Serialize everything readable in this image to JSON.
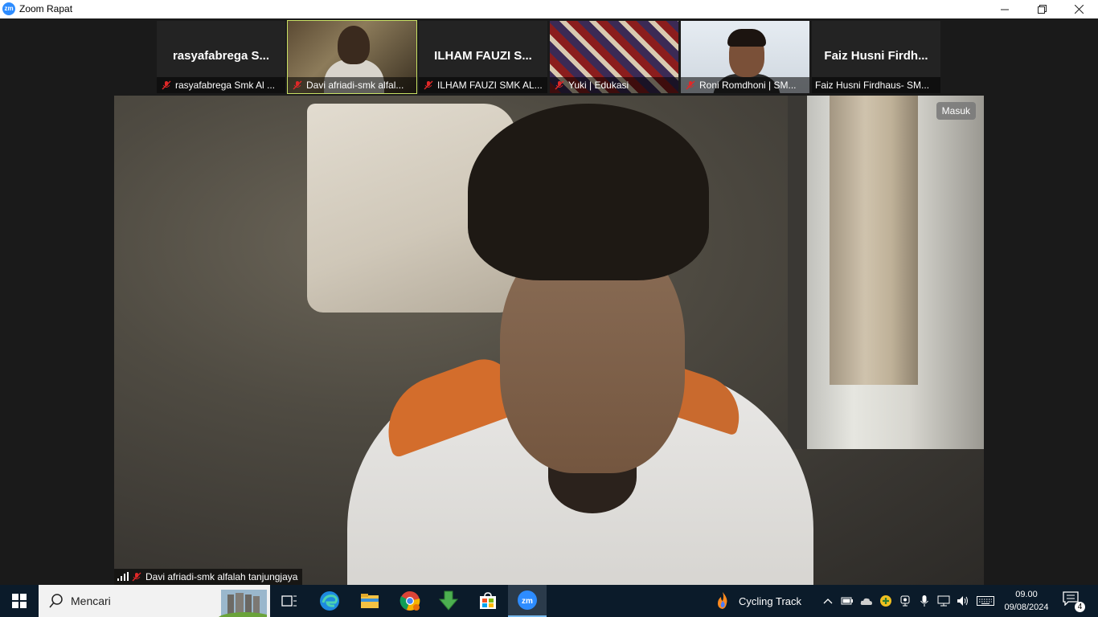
{
  "window": {
    "app_icon_text": "zm",
    "title": "Zoom Rapat"
  },
  "thumbnails": [
    {
      "display_name": "rasyafabrega  S...",
      "label": "rasyafabrega Smk Al ...",
      "video": false,
      "active": false
    },
    {
      "display_name": "",
      "label": "Davi afriadi-smk alfal...",
      "video": true,
      "active": true
    },
    {
      "display_name": "ILHAM FAUZI  S...",
      "label": "ILHAM FAUZI SMK AL...",
      "video": false,
      "active": false
    },
    {
      "display_name": "",
      "label": "Yuki | Edukasi",
      "video": true,
      "active": false
    },
    {
      "display_name": "",
      "label": "Roni Romdhoni | SM...",
      "video": true,
      "active": false
    },
    {
      "display_name": "Faiz Husni Firdh...",
      "label": "Faiz Husni Firdhaus- SM...",
      "video": false,
      "active": false
    }
  ],
  "main_video": {
    "badge": "Masuk",
    "speaker_label": "Davi afriadi-smk alfalah tanjungjaya"
  },
  "taskbar": {
    "search_placeholder": "Mencari",
    "weather_label": "Cycling Track",
    "clock_time": "09.00",
    "clock_date": "09/08/2024",
    "notification_count": "4",
    "apps": [
      "task-view-icon",
      "edge-icon",
      "file-explorer-icon",
      "chrome-icon",
      "download-icon",
      "store-icon",
      "zoom-icon"
    ]
  },
  "colors": {
    "active_thumb_border": "#c9e265",
    "zoom_blue": "#2d8cff",
    "taskbar_bg": "#0b1b2a",
    "mute_red": "#e02828"
  }
}
